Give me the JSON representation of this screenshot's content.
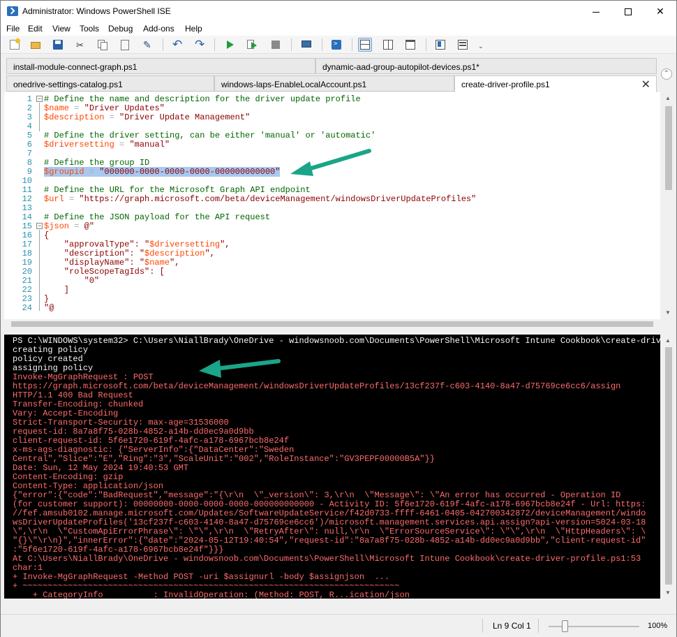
{
  "window": {
    "title": "Administrator: Windows PowerShell ISE",
    "controls": [
      "minimize",
      "maximize",
      "close"
    ]
  },
  "menu": [
    "File",
    "Edit",
    "View",
    "Tools",
    "Debug",
    "Add-ons",
    "Help"
  ],
  "toolbar_icons": [
    "new-icon",
    "open-icon",
    "save-icon",
    "cut-icon",
    "copy-icon",
    "paste-icon",
    "clear-icon",
    "undo-icon",
    "redo-icon",
    "run-icon",
    "run-selection-icon",
    "stop-icon",
    "remote-icon",
    "powershell-icon",
    "layout-top-icon",
    "layout-right-icon",
    "layout-max-icon",
    "show-addons-icon",
    "commands-icon"
  ],
  "tabs": {
    "row1": [
      "install-module-connect-graph.ps1",
      "dynamic-aad-group-autopilot-devices.ps1*"
    ],
    "row2": [
      "onedrive-settings-catalog.ps1",
      "windows-laps-EnableLocalAccount.ps1",
      "create-driver-profile.ps1"
    ],
    "active": "create-driver-profile.ps1"
  },
  "editor": {
    "line_numbers": [
      "1",
      "2",
      "3",
      "4",
      "5",
      "6",
      "7",
      "8",
      "9",
      "10",
      "11",
      "12",
      "13",
      "14",
      "15",
      "16",
      "17",
      "18",
      "19",
      "20",
      "21",
      "22",
      "23",
      "24"
    ],
    "lines": [
      [
        {
          "t": "# Define the name and description for the driver update profile",
          "c": "cm"
        }
      ],
      [
        {
          "t": "$name",
          "c": "vr"
        },
        {
          "t": " = ",
          "c": "op"
        },
        {
          "t": "\"Driver Updates\"",
          "c": "st"
        }
      ],
      [
        {
          "t": "$description",
          "c": "vr"
        },
        {
          "t": " = ",
          "c": "op"
        },
        {
          "t": "\"Driver Update Management\"",
          "c": "st"
        }
      ],
      [],
      [
        {
          "t": "# Define the driver setting, can be either 'manual' or 'automatic'",
          "c": "cm"
        }
      ],
      [
        {
          "t": "$driversetting",
          "c": "vr"
        },
        {
          "t": " = ",
          "c": "op"
        },
        {
          "t": "\"manual\"",
          "c": "st"
        }
      ],
      [],
      [
        {
          "t": "# Define the group ID",
          "c": "cm"
        }
      ],
      [
        {
          "t": "$groupid",
          "c": "vr hl"
        },
        {
          "t": " = ",
          "c": "op hl"
        },
        {
          "t": "\"000000-0000-0000-0000-000000000000\"",
          "c": "st hl"
        }
      ],
      [],
      [
        {
          "t": "# Define the URL for the Microsoft Graph API endpoint",
          "c": "cm"
        }
      ],
      [
        {
          "t": "$url",
          "c": "vr"
        },
        {
          "t": " = ",
          "c": "op"
        },
        {
          "t": "\"https://graph.microsoft.com/beta/deviceManagement/windowsDriverUpdateProfiles\"",
          "c": "st"
        }
      ],
      [],
      [
        {
          "t": "# Define the JSON payload for the API request",
          "c": "cm"
        }
      ],
      [
        {
          "t": "$json",
          "c": "vr"
        },
        {
          "t": " = ",
          "c": "op"
        },
        {
          "t": "@\"",
          "c": "st"
        }
      ],
      [
        {
          "t": "{",
          "c": "st"
        }
      ],
      [
        {
          "t": "    \"approvalType\": \"",
          "c": "st"
        },
        {
          "t": "$driversetting",
          "c": "vr"
        },
        {
          "t": "\",",
          "c": "st"
        }
      ],
      [
        {
          "t": "    \"description\": \"",
          "c": "st"
        },
        {
          "t": "$description",
          "c": "vr"
        },
        {
          "t": "\",",
          "c": "st"
        }
      ],
      [
        {
          "t": "    \"displayName\": \"",
          "c": "st"
        },
        {
          "t": "$name",
          "c": "vr"
        },
        {
          "t": "\",",
          "c": "st"
        }
      ],
      [
        {
          "t": "    \"roleScopeTagIds\": [",
          "c": "st"
        }
      ],
      [
        {
          "t": "        \"0\"",
          "c": "st"
        }
      ],
      [
        {
          "t": "    ]",
          "c": "st"
        }
      ],
      [
        {
          "t": "}",
          "c": "st"
        }
      ],
      [
        {
          "t": "\"@",
          "c": "st"
        }
      ]
    ]
  },
  "console": {
    "lines": [
      {
        "t": "PS C:\\WINDOWS\\system32> C:\\Users\\NiallBrady\\OneDrive - windowsnoob.com\\Documents\\PowerShell\\Microsoft Intune Cookbook\\create-driv",
        "c": "cw"
      },
      {
        "t": "creating policy",
        "c": "cw"
      },
      {
        "t": "policy created",
        "c": "cw"
      },
      {
        "t": "assigning policy",
        "c": "cw"
      },
      {
        "t": "Invoke-MgGraphRequest : POST",
        "c": "ce"
      },
      {
        "t": "https://graph.microsoft.com/beta/deviceManagement/windowsDriverUpdateProfiles/13cf237f-c603-4140-8a47-d75769ce6cc6/assign",
        "c": "ce"
      },
      {
        "t": "HTTP/1.1 400 Bad Request",
        "c": "ce"
      },
      {
        "t": "Transfer-Encoding: chunked",
        "c": "ce"
      },
      {
        "t": "Vary: Accept-Encoding",
        "c": "ce"
      },
      {
        "t": "Strict-Transport-Security: max-age=31536000",
        "c": "ce"
      },
      {
        "t": "request-id: 8a7a8f75-028b-4852-a14b-dd0ec9a0d9bb",
        "c": "ce"
      },
      {
        "t": "client-request-id: 5f6e1720-619f-4afc-a178-6967bcb8e24f",
        "c": "ce"
      },
      {
        "t": "x-ms-ags-diagnostic: {\"ServerInfo\":{\"DataCenter\":\"Sweden",
        "c": "ce"
      },
      {
        "t": "Central\",\"Slice\":\"E\",\"Ring\":\"3\",\"ScaleUnit\":\"002\",\"RoleInstance\":\"GV3PEPF00000B5A\"}}",
        "c": "ce"
      },
      {
        "t": "Date: Sun, 12 May 2024 19:40:53 GMT",
        "c": "ce"
      },
      {
        "t": "Content-Encoding: gzip",
        "c": "ce"
      },
      {
        "t": "Content-Type: application/json",
        "c": "ce"
      },
      {
        "t": "{\"error\":{\"code\":\"BadRequest\",\"message\":\"{\\r\\n  \\\"_version\\\": 3,\\r\\n  \\\"Message\\\": \\\"An error has occurred - Operation ID",
        "c": "ce"
      },
      {
        "t": "(for customer support): 00000000-0000-0000-0000-000000000000 - Activity ID: 5f6e1720-619f-4afc-a178-6967bcb8e24f - Url: https:",
        "c": "ce"
      },
      {
        "t": "//fef.amsub0102.manage.microsoft.com/Updates/SoftwareUpdateService/f42d0733-ffff-6461-0405-042700342872/deviceManagement/windo",
        "c": "ce"
      },
      {
        "t": "wsDriverUpdateProfiles('13cf237f-c603-4140-8a47-d75769ce6cc6')/microsoft.management.services.api.assign?api-version=5024-03-18",
        "c": "ce"
      },
      {
        "t": "\\\",\\r\\n  \\\"CustomApiErrorPhrase\\\": \\\"\\\",\\r\\n  \\\"RetryAfter\\\": null,\\r\\n  \\\"ErrorSourceService\\\": \\\"\\\",\\r\\n  \\\"HttpHeaders\\\": \\",
        "c": "ce"
      },
      {
        "t": "\"{}\\\"\\r\\n}\",\"innerError\":{\"date\":\"2024-05-12T19:40:54\",\"request-id\":\"8a7a8f75-028b-4852-a14b-dd0ec9a0d9bb\",\"client-request-id\"",
        "c": "ce"
      },
      {
        "t": ":\"5f6e1720-619f-4afc-a178-6967bcb8e24f\"}}}",
        "c": "ce"
      },
      {
        "t": "At C:\\Users\\NiallBrady\\OneDrive - windowsnoob.com\\Documents\\PowerShell\\Microsoft Intune Cookbook\\create-driver-profile.ps1:53",
        "c": "ce"
      },
      {
        "t": "char:1",
        "c": "ce"
      },
      {
        "t": "+ Invoke-MgGraphRequest -Method POST -uri $assignurl -body $assignjson  ...",
        "c": "ce"
      },
      {
        "t": "+ ~~~~~~~~~~~~~~~~~~~~~~~~~~~~~~~~~~~~~~~~~~~~~~~~~~~~~~~~~~~~~~~~~~~~~~~~~~~",
        "c": "ce"
      },
      {
        "t": "    + CategoryInfo          : InvalidOperation: (Method: POST, R...ication/json",
        "c": "ce"
      }
    ]
  },
  "status": {
    "position": "Ln 9  Col 1",
    "zoom": "100%",
    "zoom_level_fraction": 0.18
  },
  "colors": {
    "annotation_arrow": "#1aa589",
    "console_error": "#ff6b6b",
    "selection": "#a8c8f0"
  }
}
